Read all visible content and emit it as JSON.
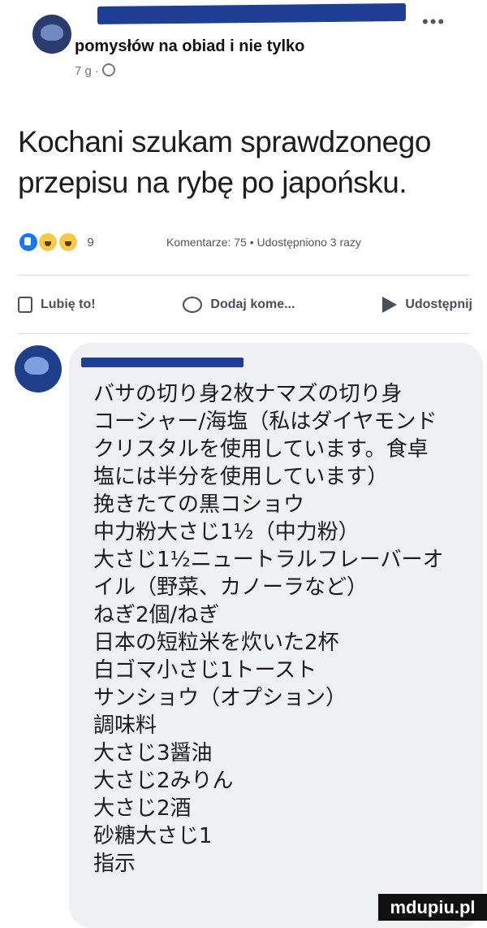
{
  "header": {
    "group_name": "pomysłów na obiad i nie tylko",
    "post_meta": "7 g ·",
    "more": "•••"
  },
  "post": {
    "text": "Kochani szukam sprawdzonego przepisu na rybę po japońsku.",
    "reaction_count": "9",
    "comment_stats": "Komentarze: 75 • Udostępniono 3 razy"
  },
  "actions": {
    "like": "Lubię to!",
    "comment": "Dodaj kome...",
    "share": "Udostępnij"
  },
  "comment": {
    "body": "バサの切り身2枚ナマズの切り身\nコーシャー/海塩（私はダイヤモンド\nクリスタルを使用しています。食卓\n塩には半分を使用しています）\n挽きたての黒コショウ\n中力粉大さじ1½（中力粉）\n大さじ1½ニュートラルフレーバーオ\nイル（野菜、カノーラなど）\nねぎ2個/ねぎ\n日本の短粒米を炊いた2杯\n白ゴマ小さじ1トースト\nサンショウ（オプション）\n調味料\n大さじ3醤油\n大さじ2みりん\n大さじ2酒\n砂糖大さじ1\n指示"
  },
  "watermark": "mdupiu.pl",
  "icons": {
    "like": "thumbs-up-icon",
    "comment": "comment-bubble-icon",
    "share": "share-arrow-icon",
    "globe": "globe-icon",
    "more": "more-dots-icon"
  }
}
